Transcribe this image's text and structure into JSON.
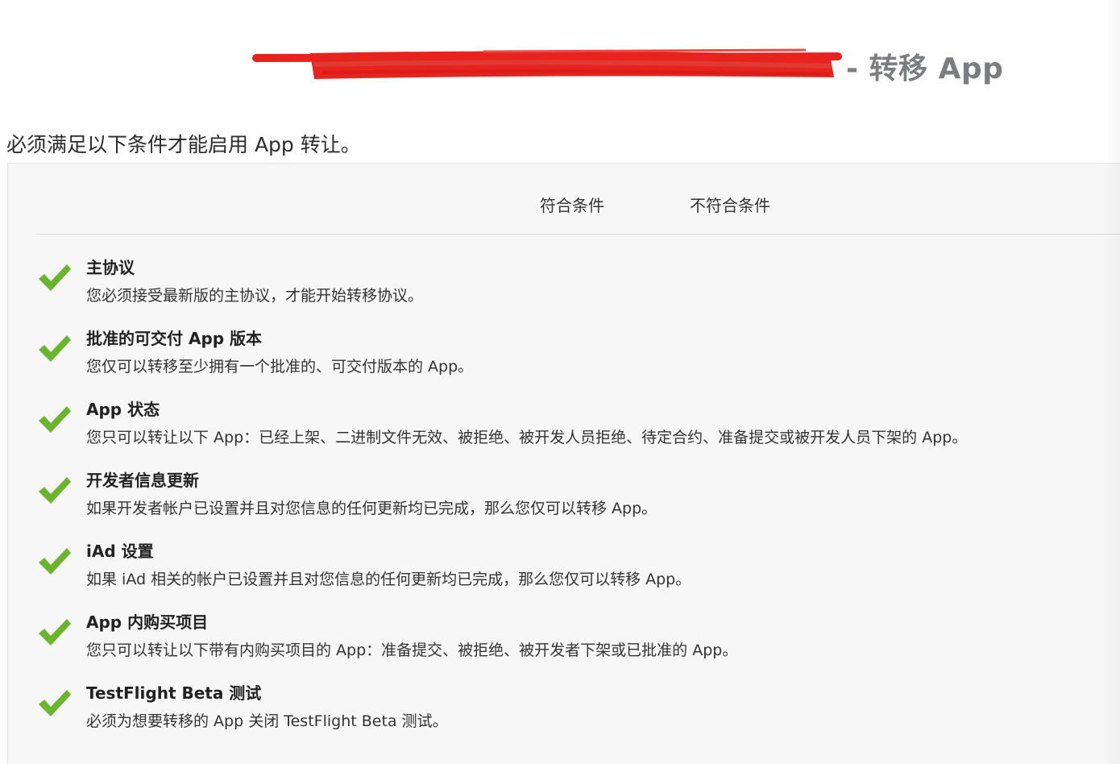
{
  "header": {
    "title": "- 转移 App",
    "redaction_color": "#e8231e"
  },
  "intro": {
    "text": "必须满足以下条件才能启用 App 转让。"
  },
  "table": {
    "columns": {
      "meets": "符合条件",
      "not_meets": "不符合条件"
    },
    "check_color": "#6bb52d",
    "criteria": [
      {
        "title": "主协议",
        "description": "您必须接受最新版的主协议，才能开始转移协议。",
        "status": "meets"
      },
      {
        "title": "批准的可交付 App 版本",
        "description": "您仅可以转移至少拥有一个批准的、可交付版本的 App。",
        "status": "meets"
      },
      {
        "title": "App 状态",
        "description": "您只可以转让以下 App：已经上架、二进制文件无效、被拒绝、被开发人员拒绝、待定合约、准备提交或被开发人员下架的 App。",
        "status": "meets"
      },
      {
        "title": "开发者信息更新",
        "description": "如果开发者帐户已设置并且对您信息的任何更新均已完成，那么您仅可以转移 App。",
        "status": "meets"
      },
      {
        "title": "iAd 设置",
        "description": "如果 iAd 相关的帐户已设置并且对您信息的任何更新均已完成，那么您仅可以转移 App。",
        "status": "meets"
      },
      {
        "title": "App 内购买项目",
        "description": "您只可以转让以下带有内购买项目的 App：准备提交、被拒绝、被开发者下架或已批准的 App。",
        "status": "meets"
      },
      {
        "title": "TestFlight Beta 测试",
        "description": "必须为想要转移的 App 关闭 TestFlight Beta 测试。",
        "status": "meets"
      }
    ]
  }
}
